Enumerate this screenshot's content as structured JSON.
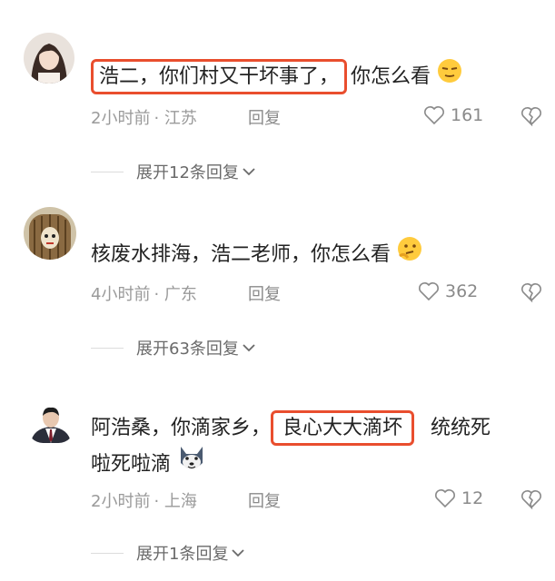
{
  "comments": [
    {
      "username": "",
      "segments": [
        "浩二，你们村又干坏事了，",
        "你怎么看"
      ],
      "highlight_index": 0,
      "emoji": "wry-smile-emoji",
      "time": "2小时前",
      "location": "· 江苏",
      "reply_label": "回复",
      "likes": "161",
      "expand_label": "展开12条回复"
    },
    {
      "username": "",
      "segments": [
        "核废水排海，浩二老师，你怎么看"
      ],
      "emoji": "thinking-emoji",
      "time": "4小时前",
      "location": "· 广东",
      "reply_label": "回复",
      "likes": "362",
      "expand_label": "展开63条回复"
    },
    {
      "username": "",
      "line1_before": "阿浩桑，你滴家乡，",
      "line1_highlight": "良心大大滴坏",
      "line1_after": "统统死",
      "line2": "啦死啦滴",
      "emoji": "husky-dog-emoji",
      "time": "2小时前",
      "location": "· 上海",
      "reply_label": "回复",
      "likes": "12",
      "expand_label": "展开1条回复"
    }
  ],
  "colors": {
    "highlight": "#e94e2e",
    "meta": "#9a9a9a",
    "text": "#222222"
  }
}
